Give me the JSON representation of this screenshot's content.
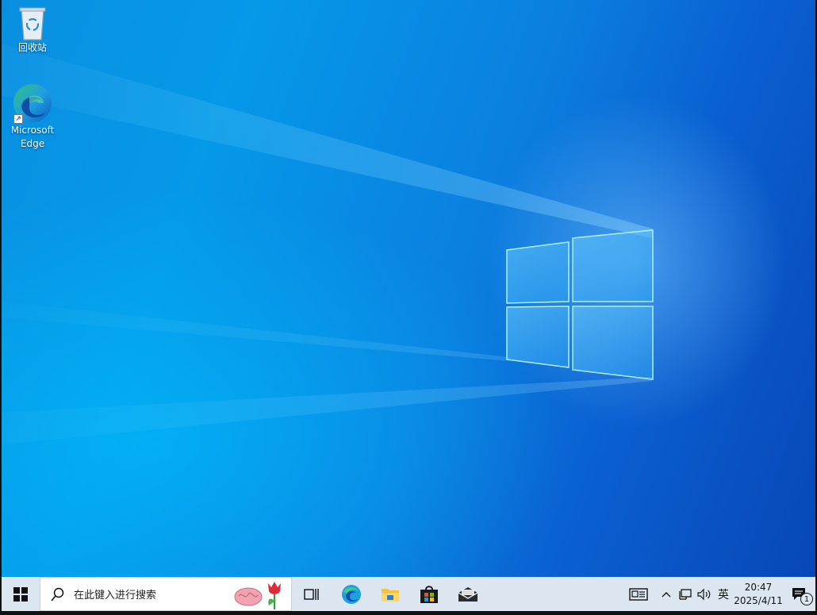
{
  "desktop": {
    "icons": [
      {
        "label": "回收站",
        "icon": "recycle-bin-icon"
      },
      {
        "label": "Microsoft Edge",
        "label_line1": "Microsoft",
        "label_line2": "Edge",
        "icon": "edge-icon"
      }
    ]
  },
  "taskbar": {
    "start_icon": "windows-logo-icon",
    "search": {
      "placeholder": "在此键入进行搜索",
      "icon": "search-icon",
      "decor": [
        "brain-emoji",
        "tulip-emoji"
      ]
    },
    "apps": [
      "task-view-icon",
      "edge-icon",
      "file-explorer-icon",
      "store-icon",
      "mail-icon"
    ],
    "tray": {
      "news_icon": "news-icon",
      "show_hidden_icon": "chevron-up-icon",
      "network_icon": "network-icon",
      "volume_icon": "volume-icon",
      "ime": "英",
      "time": "20:47",
      "date": "2025/4/11",
      "notification_count": "1"
    }
  },
  "colors": {
    "taskbar_bg": "#dbe6f1",
    "desktop_accent": "#0a8fe0"
  }
}
